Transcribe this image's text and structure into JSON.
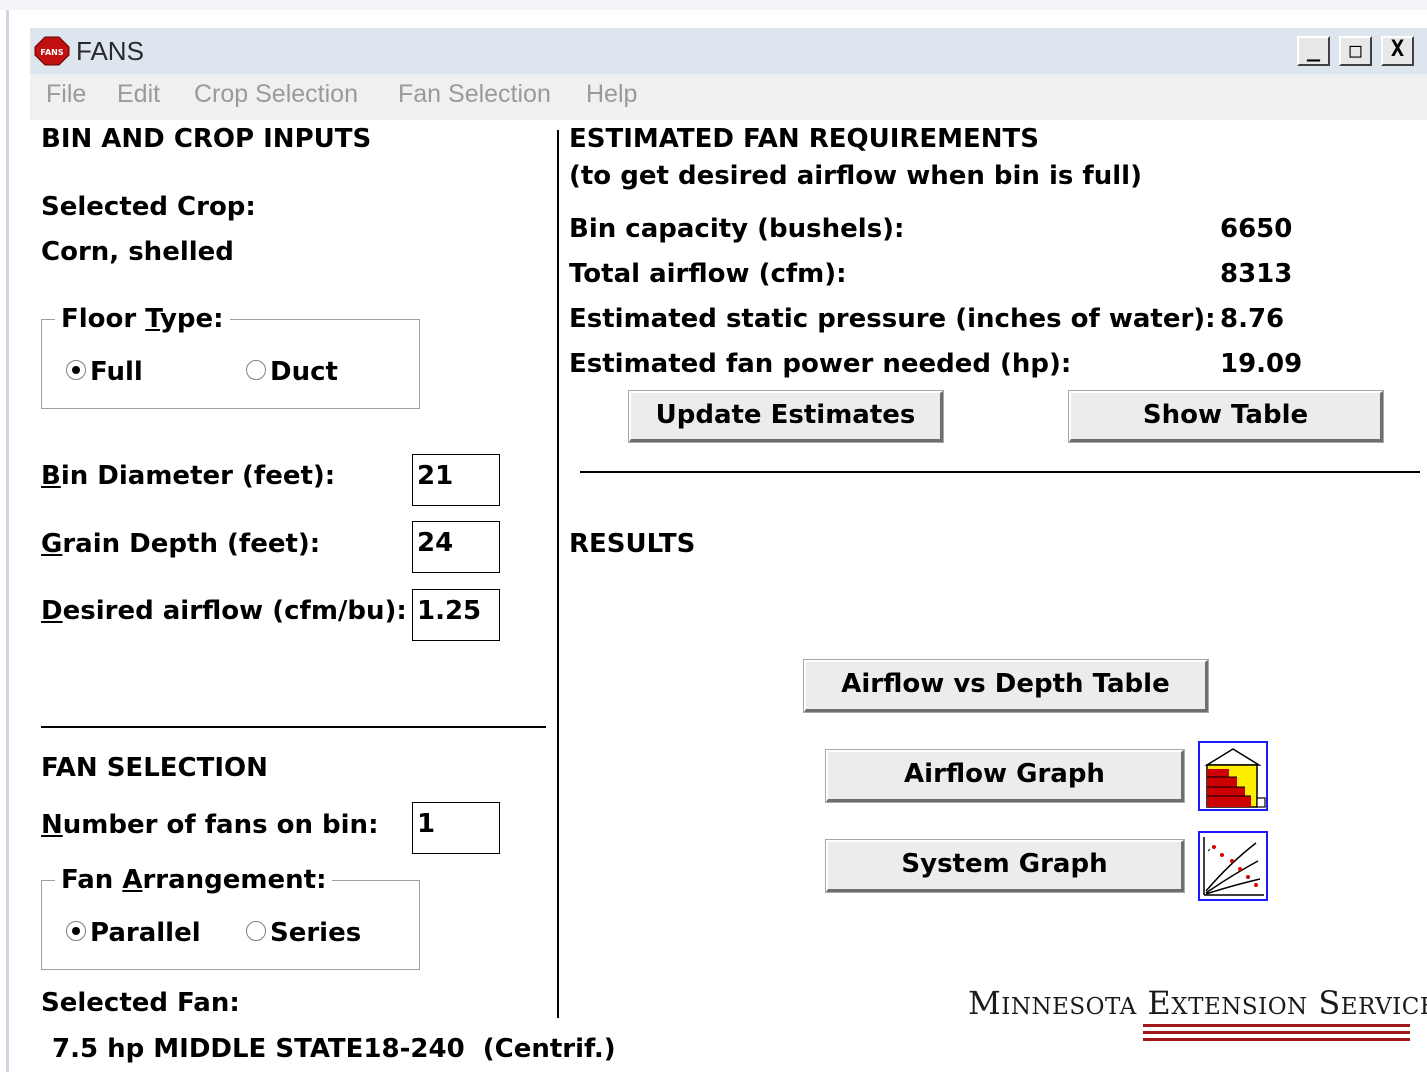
{
  "window": {
    "title": "FANS",
    "icon": "stop-sign-icon",
    "controls": {
      "minimize": "_",
      "maximize": "□",
      "close": "X"
    }
  },
  "menu": [
    "File",
    "Edit",
    "Crop Selection",
    "Fan Selection",
    "Help"
  ],
  "bin_inputs": {
    "heading": "BIN AND CROP INPUTS",
    "selected_crop_label": "Selected Crop:",
    "selected_crop_value": "Corn, shelled",
    "floor_type": {
      "title_pre": "Floor ",
      "title_ul": "T",
      "title_post": "ype:",
      "options": [
        "Full",
        "Duct"
      ],
      "selected": "Full"
    },
    "bin_diameter": {
      "label_ul": "B",
      "label_rest": "in Diameter (feet):",
      "value": "21"
    },
    "grain_depth": {
      "label_ul": "G",
      "label_rest": "rain Depth (feet):",
      "value": "24"
    },
    "desired_airflow": {
      "label_ul": "D",
      "label_rest": "esired airflow (cfm/bu):",
      "value": "1.25"
    }
  },
  "fan_selection": {
    "heading": "FAN SELECTION",
    "num_fans": {
      "label_ul": "N",
      "label_rest": "umber of fans on bin:",
      "value": "1"
    },
    "arrangement": {
      "title_pre": "Fan ",
      "title_ul": "A",
      "title_post": "rrangement:",
      "options": [
        "Parallel",
        "Series"
      ],
      "selected": "Parallel"
    },
    "selected_fan_label": "Selected Fan:",
    "selected_fan_value": "7.5 hp MIDDLE STATE18-240  (Centrif.)"
  },
  "estimates": {
    "heading": "ESTIMATED FAN REQUIREMENTS",
    "subheading": "(to get desired airflow when bin is full)",
    "rows": [
      {
        "label": "Bin capacity (bushels):",
        "value": "6650"
      },
      {
        "label": "Total airflow (cfm):",
        "value": "8313"
      },
      {
        "label": "Estimated static pressure (inches of water):",
        "value": "8.76"
      },
      {
        "label": "Estimated fan power needed (hp):",
        "value": "19.09"
      }
    ],
    "update_button": "Update Estimates",
    "show_table_button": "Show Table"
  },
  "results": {
    "heading": "RESULTS",
    "airflow_depth_button": "Airflow vs Depth Table",
    "airflow_graph_button": "Airflow Graph",
    "system_graph_button": "System Graph",
    "airflow_graph_icon": "grain-bin-icon",
    "system_graph_icon": "system-curve-icon"
  },
  "branding": {
    "text_parts": [
      {
        "big": "M",
        "small": "INNESOTA"
      },
      {
        "big": "E",
        "small": "XTENSION"
      },
      {
        "big": "S",
        "small": "ERVICE"
      }
    ],
    "accent_color": "#a01818"
  },
  "colors": {
    "titlebar": "#dde5ef",
    "menubar": "#f0f0f0",
    "icon_border": "#1a1aff",
    "bin_red": "#cc0000",
    "bin_yellow": "#ffee00"
  }
}
